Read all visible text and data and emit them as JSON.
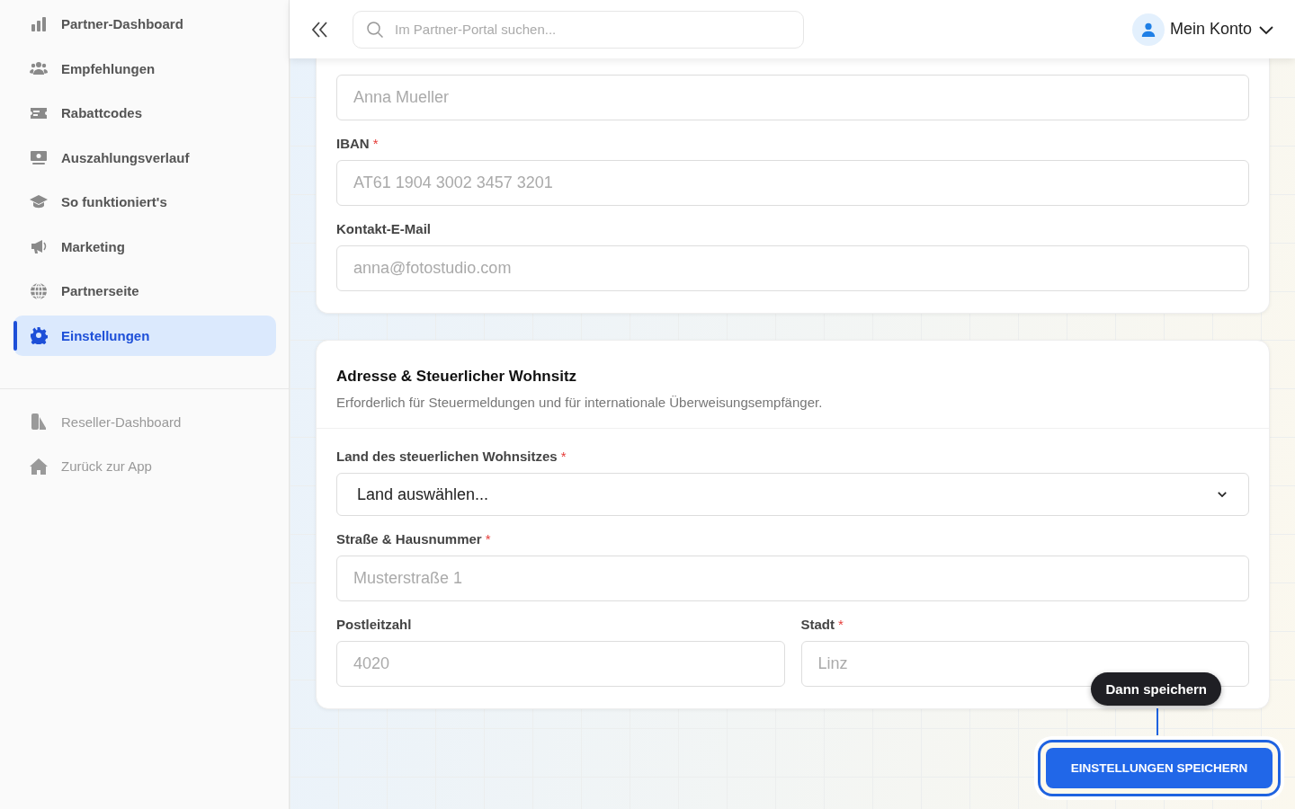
{
  "sidebar": {
    "items": [
      {
        "label": "Partner-Dashboard",
        "kind": "bars",
        "selected": false,
        "disabled": false
      },
      {
        "label": "Empfehlungen",
        "kind": "people",
        "selected": false,
        "disabled": false
      },
      {
        "label": "Rabattcodes",
        "kind": "ticket",
        "selected": false,
        "disabled": false
      },
      {
        "label": "Auszahlungsverlauf",
        "kind": "money",
        "selected": false,
        "disabled": false
      },
      {
        "label": "So funktioniert's",
        "kind": "cap",
        "selected": false,
        "disabled": false
      },
      {
        "label": "Marketing",
        "kind": "megaphone",
        "selected": false,
        "disabled": false
      },
      {
        "label": "Partnerseite",
        "kind": "globe",
        "selected": false,
        "disabled": false
      },
      {
        "label": "Einstellungen",
        "kind": "gear",
        "selected": true,
        "disabled": false
      }
    ],
    "secondary_items": [
      {
        "label": "Reseller-Dashboard",
        "kind": "reseller",
        "selected": false,
        "disabled": true
      },
      {
        "label": "Zurück zur App",
        "kind": "home",
        "selected": false,
        "disabled": true
      }
    ]
  },
  "header": {
    "search": {
      "placeholder": "Im Partner-Portal suchen..."
    },
    "account": {
      "label": "Mein Konto"
    }
  },
  "cards": [
    {
      "rows": [
        [
          {
            "kind": "input",
            "placeholder": "Anna Mueller"
          }
        ],
        [
          {
            "kind": "input",
            "label": "IBAN",
            "required_mark": "*",
            "placeholder": "AT61 1904 3002 3457 3201"
          }
        ],
        [
          {
            "kind": "input",
            "label": "Kontakt-E-Mail",
            "placeholder": "anna@fotostudio.com"
          }
        ]
      ]
    },
    {
      "title": "Adresse & Steuerlicher Wohnsitz",
      "description": "Erforderlich für Steuermeldungen und für internationale Überweisungsempfänger.",
      "rows": [
        [
          {
            "kind": "select",
            "label": "Land des steuerlichen Wohnsitzes",
            "required_mark": "*",
            "value": "Land auswählen..."
          }
        ],
        [
          {
            "kind": "input",
            "label": "Straße & Hausnummer",
            "required_mark": "*",
            "placeholder": "Musterstraße 1"
          }
        ],
        [
          {
            "kind": "input",
            "label": "Postleitzahl",
            "placeholder": "4020"
          },
          {
            "kind": "input",
            "label": "Stadt",
            "required_mark": "*",
            "placeholder": "Linz"
          }
        ]
      ]
    }
  ],
  "save_button": {
    "label": "EINSTELLUNGEN SPEICHERN",
    "highlighted": true
  },
  "tooltip": {
    "text": "Dann speichern"
  }
}
